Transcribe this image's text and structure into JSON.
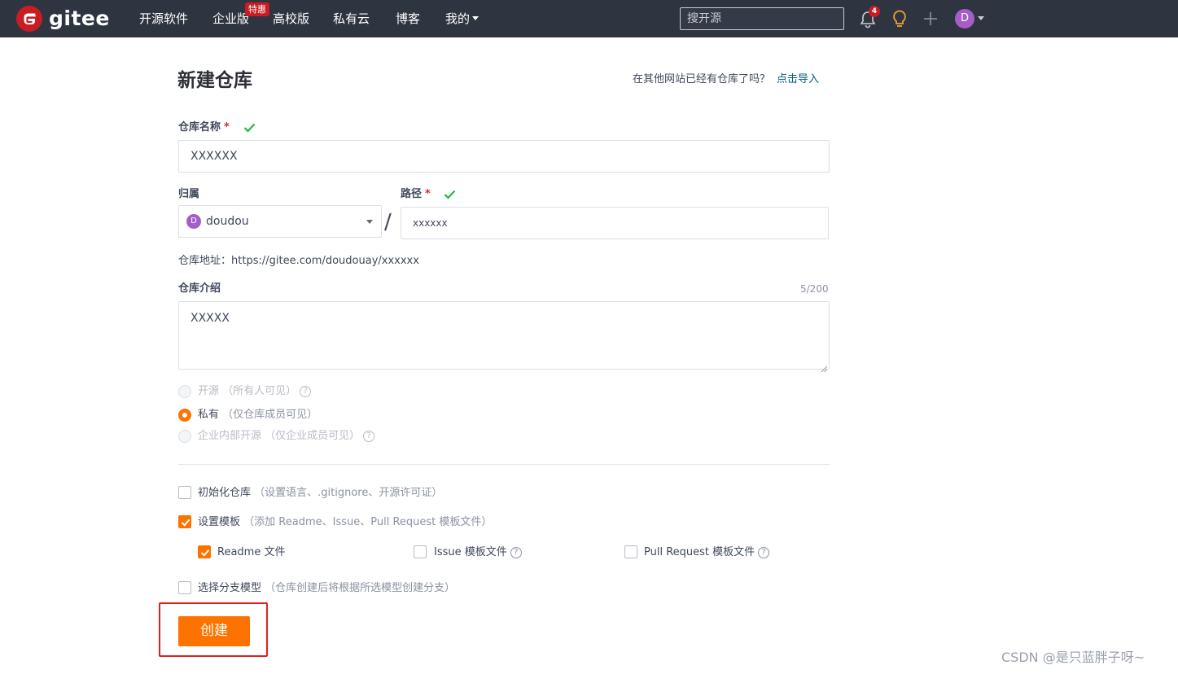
{
  "nav": {
    "brand": "gitee",
    "items": [
      "开源软件",
      "企业版",
      "高校版",
      "私有云",
      "博客",
      "我的"
    ],
    "enterprise_badge": "特惠",
    "search_placeholder": "搜开源",
    "notification_count": "4",
    "avatar_letter": "D"
  },
  "page": {
    "title": "新建仓库",
    "import_hint": "在其他网站已经有仓库了吗？",
    "import_link": "点击导入"
  },
  "form": {
    "repo_name_label": "仓库名称",
    "required_mark": "*",
    "repo_name_value": "XXXXXX",
    "owner_label": "归属",
    "owner_avatar_letter": "D",
    "owner_value": "doudou",
    "path_label": "路径",
    "slash": "/",
    "path_value": "xxxxxx",
    "address_label": "仓库地址：",
    "address_value": "https://gitee.com/doudouay/xxxxxx",
    "intro_label": "仓库介绍",
    "intro_counter": "5/200",
    "intro_value": "XXXXX",
    "visibility": [
      {
        "label": "开源",
        "note": "（所有人可见）",
        "help": "?",
        "selected": false,
        "disabled": true
      },
      {
        "label": "私有",
        "note": "（仅仓库成员可见）",
        "help": "",
        "selected": true,
        "disabled": false
      },
      {
        "label": "企业内部开源",
        "note": "（仅企业成员可见）",
        "help": "?",
        "selected": false,
        "disabled": true
      }
    ],
    "init_repo": {
      "label": "初始化仓库",
      "note": "（设置语言、.gitignore、开源许可证）",
      "checked": false
    },
    "set_template": {
      "label": "设置模板",
      "note": "（添加 Readme、Issue、Pull Request 模板文件）",
      "checked": true
    },
    "templates": [
      {
        "label": "Readme 文件",
        "checked": true,
        "help": ""
      },
      {
        "label": "Issue 模板文件",
        "checked": false,
        "help": "?"
      },
      {
        "label": "Pull Request 模板文件",
        "checked": false,
        "help": "?"
      }
    ],
    "branch_model": {
      "label": "选择分支模型",
      "note": "（仓库创建后将根据所选模型创建分支）",
      "checked": false
    },
    "create_button": "创建"
  },
  "watermark": "CSDN @是只蓝胖子呀~",
  "colors": {
    "navbar": "#2f3441",
    "brand_red": "#c71d23",
    "accent_orange": "#fe7300",
    "link_blue": "#005980",
    "check_green": "#21ba45",
    "highlight_red": "#e02020"
  }
}
